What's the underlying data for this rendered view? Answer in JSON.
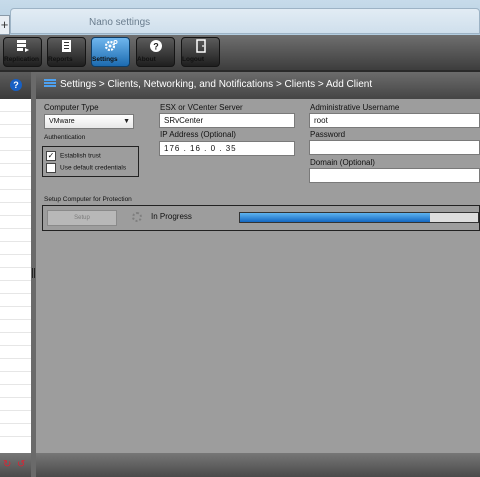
{
  "browser": {
    "new_tab": "+",
    "tab_title": "Nano settings"
  },
  "toolbar": {
    "buttons": [
      {
        "label": "Replication",
        "icon": "replication-icon"
      },
      {
        "label": "Reports",
        "icon": "reports-icon"
      },
      {
        "label": "Settings",
        "icon": "gear-icon",
        "active": true
      },
      {
        "label": "About",
        "icon": "help-icon"
      },
      {
        "label": "Logout",
        "icon": "door-icon"
      }
    ]
  },
  "sidebar": {
    "help_glyph": "?"
  },
  "breadcrumb": "Settings > Clients, Networking, and Notifications > Clients > Add Client",
  "form": {
    "computer_type_label": "Computer Type",
    "computer_type_value": "VMware",
    "authentication_label": "Authentication",
    "establish_trust_label": "Establish trust",
    "establish_trust_checked": true,
    "use_default_credentials_label": "Use default credentials",
    "use_default_credentials_checked": false,
    "esx_label": "ESX or VCenter Server",
    "esx_value": "SRvCenter",
    "ip_label": "IP Address (Optional)",
    "ip_value": "176 . 16 . 0 . 35",
    "admin_user_label": "Administrative Username",
    "admin_user_value": "root",
    "password_label": "Password",
    "password_value": "",
    "domain_label": "Domain (Optional)",
    "domain_value": ""
  },
  "protection": {
    "section_label": "Setup Computer for Protection",
    "setup_button": "Setup",
    "status_text": "In Progress",
    "progress": 0.8
  },
  "colors": {
    "accent": "#1c6bb0",
    "progress": "#1468c2"
  }
}
